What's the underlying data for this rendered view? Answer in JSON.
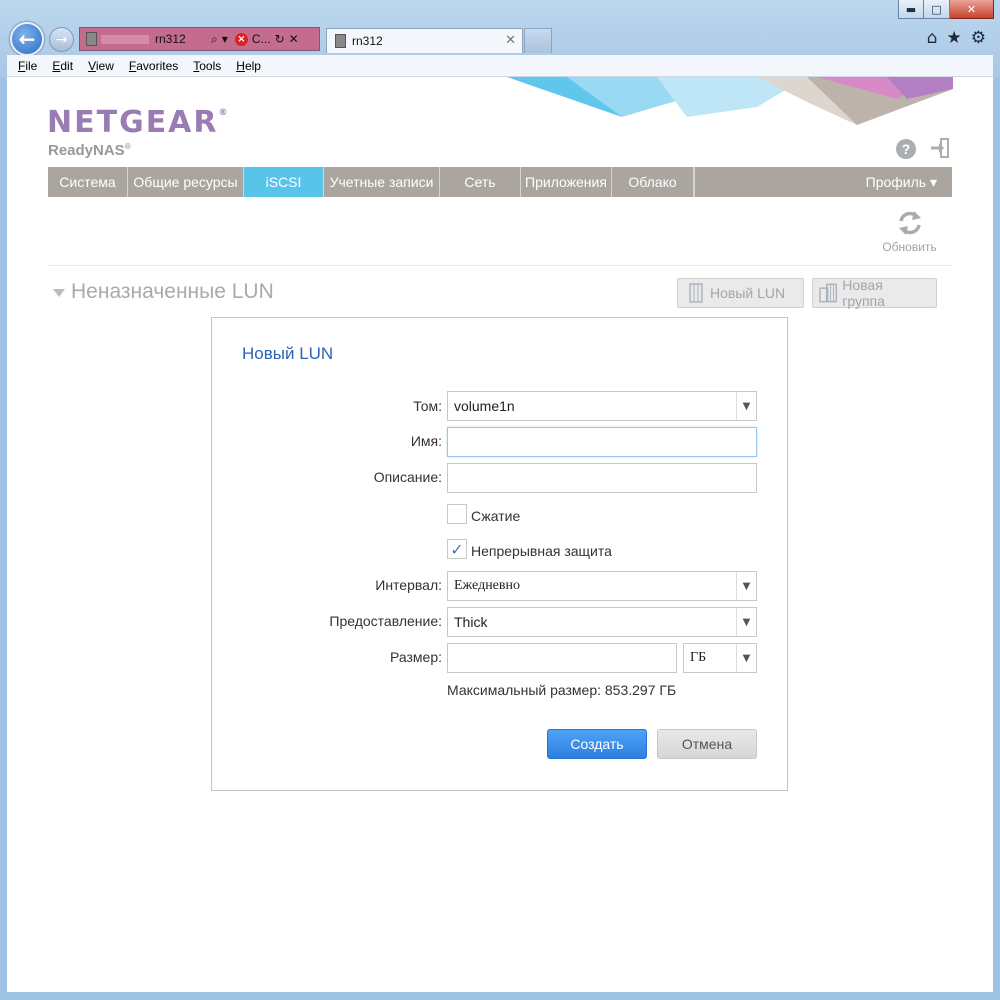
{
  "browser": {
    "window_controls": {
      "minimize": "▬",
      "maximize": "□",
      "close": "✕"
    },
    "address": {
      "url": "rn312",
      "c_label": "C..."
    },
    "tab": {
      "title": "rn312",
      "close": "✕"
    },
    "menu": [
      {
        "key": "F",
        "rest": "ile"
      },
      {
        "key": "E",
        "rest": "dit"
      },
      {
        "key": "V",
        "rest": "iew"
      },
      {
        "key": "F",
        "rest": "avorites"
      },
      {
        "key": "T",
        "rest": "ools"
      },
      {
        "key": "H",
        "rest": "elp"
      }
    ]
  },
  "header": {
    "brand": "NETGEAR",
    "brand_mark": "®",
    "product": "ReadyNAS",
    "product_mark": "®",
    "help_glyph": "?"
  },
  "nav": {
    "items": [
      "Система",
      "Общие ресурсы",
      "iSCSI",
      "Учетные записи",
      "Сеть",
      "Приложения",
      "Облако"
    ],
    "active_index": 2,
    "profile": "Профиль ▾"
  },
  "toolbar": {
    "refresh_label": "Обновить"
  },
  "section": {
    "title": "Неназначенные LUN",
    "new_lun_button": "Новый LUN",
    "new_group_button": "Новая группа"
  },
  "dialog": {
    "title": "Новый LUN",
    "volume": {
      "label": "Том:",
      "value": "volume1n"
    },
    "name": {
      "label": "Имя:",
      "value": ""
    },
    "description": {
      "label": "Описание:",
      "value": ""
    },
    "compression": {
      "label": "Сжатие",
      "checked": false
    },
    "continuous_protection": {
      "label": "Непрерывная защита",
      "checked": true,
      "mark": "✓"
    },
    "interval": {
      "label": "Интервал:",
      "value": "Ежедневно"
    },
    "provisioning": {
      "label": "Предоставление:",
      "value": "Thick"
    },
    "size": {
      "label": "Размер:",
      "value": "",
      "unit": "ГБ"
    },
    "max_size": "Максимальный размер: 853.297 ГБ",
    "create_button": "Создать",
    "cancel_button": "Отмена"
  },
  "colors": {
    "accent_active_tab": "#59c4ea",
    "nav_bg": "#aaa59f",
    "brand_purple": "#9a7bb4",
    "primary_button": "#2d7fe0",
    "dialog_title": "#2a64b8"
  }
}
